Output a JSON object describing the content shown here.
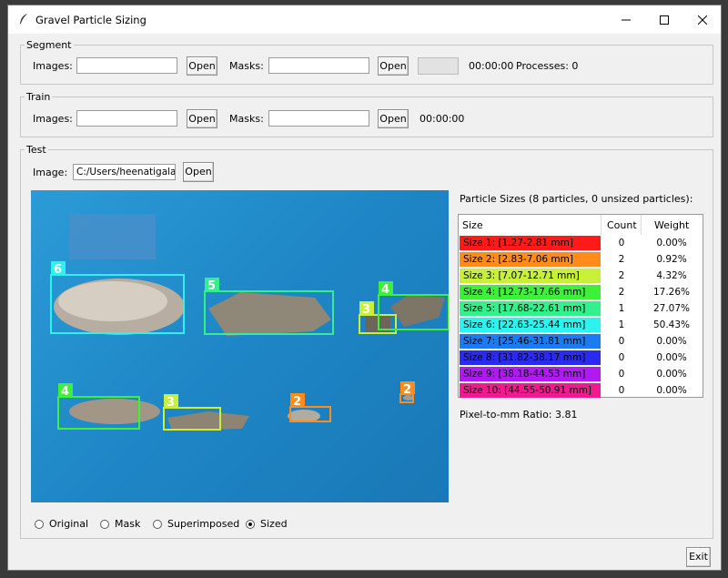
{
  "window": {
    "title": "Gravel Particle Sizing",
    "minimize": "—",
    "maximize": "☐",
    "close": "✕"
  },
  "segment": {
    "legend": "Segment",
    "images_label": "Images:",
    "images_value": "",
    "open_images": "Open",
    "masks_label": "Masks:",
    "masks_value": "",
    "open_masks": "Open",
    "progress": 0,
    "time": "00:00:00",
    "processes": "Processes: 0"
  },
  "train": {
    "legend": "Train",
    "images_label": "Images:",
    "images_value": "",
    "open_images": "Open",
    "masks_label": "Masks:",
    "masks_value": "",
    "open_masks": "Open",
    "time": "00:00:00"
  },
  "test": {
    "legend": "Test",
    "image_label": "Image:",
    "image_value": "C:/Users/heenatigalaka",
    "open_image": "Open",
    "particle_sizes_title": "Particle Sizes (8 particles, 0 unsized particles):",
    "table": {
      "headers": [
        "Size",
        "Count",
        "Weight"
      ],
      "rows": [
        {
          "size": "Size 1: [1.27-2.81 mm]",
          "count": "0",
          "weight": "0.00%",
          "color": "#ff1a1a"
        },
        {
          "size": "Size 2: [2.83-7.06 mm]",
          "count": "2",
          "weight": "0.92%",
          "color": "#ff8c1a"
        },
        {
          "size": "Size 3: [7.07-12.71 mm]",
          "count": "2",
          "weight": "4.32%",
          "color": "#c8f03a"
        },
        {
          "size": "Size 4: [12.73-17.66 mm]",
          "count": "2",
          "weight": "17.26%",
          "color": "#3ef03a"
        },
        {
          "size": "Size 5: [17.68-22.61 mm]",
          "count": "1",
          "weight": "27.07%",
          "color": "#33f08c"
        },
        {
          "size": "Size 6: [22.63-25.44 mm]",
          "count": "1",
          "weight": "50.43%",
          "color": "#2cf2f0"
        },
        {
          "size": "Size 7: [25.46-31.81 mm]",
          "count": "0",
          "weight": "0.00%",
          "color": "#1a7cf0"
        },
        {
          "size": "Size 8: [31.82-38.17 mm]",
          "count": "0",
          "weight": "0.00%",
          "color": "#2b2bf0"
        },
        {
          "size": "Size 9: [38.18-44.53 mm]",
          "count": "0",
          "weight": "0.00%",
          "color": "#b01af0"
        },
        {
          "size": "Size 10: [44.55-50.91 mm]",
          "count": "0",
          "weight": "0.00%",
          "color": "#f01a90"
        }
      ]
    },
    "ratio": "Pixel-to-mm Ratio: 3.81",
    "view_options": [
      {
        "label": "Original",
        "selected": false
      },
      {
        "label": "Mask",
        "selected": false
      },
      {
        "label": "Superimposed",
        "selected": false
      },
      {
        "label": "Sized",
        "selected": true
      }
    ],
    "particle_labels": [
      "6",
      "5",
      "3",
      "4",
      "4",
      "3",
      "2",
      "2"
    ]
  },
  "exit_label": "Exit"
}
